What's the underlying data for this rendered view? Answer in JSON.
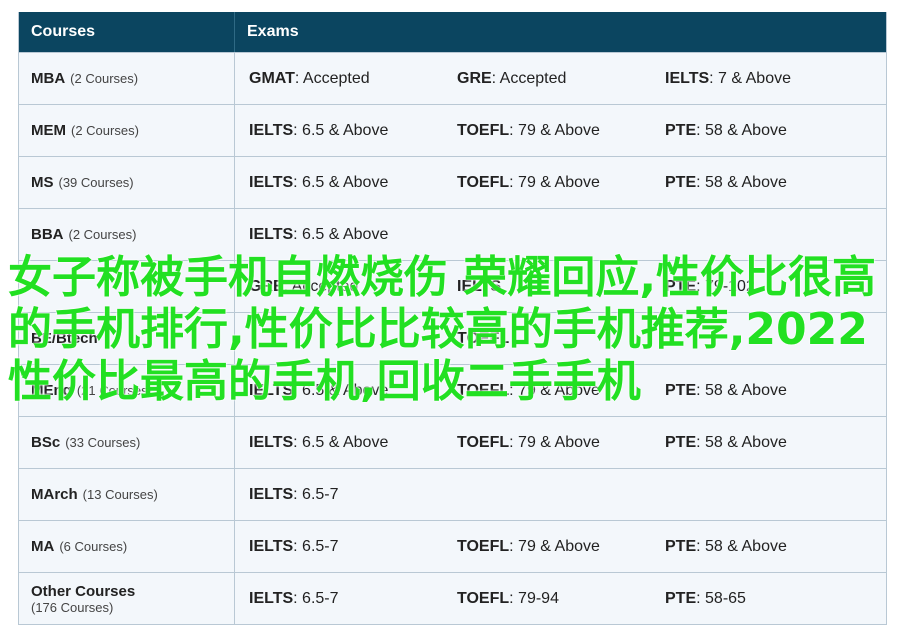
{
  "header": {
    "courses": "Courses",
    "exams": "Exams"
  },
  "rows": [
    {
      "name": "MBA",
      "count": "(2 Courses)",
      "exams": [
        {
          "name": "GMAT",
          "value": ": Accepted"
        },
        {
          "name": "GRE",
          "value": ": Accepted"
        },
        {
          "name": "IELTS",
          "value": ": 7 & Above"
        }
      ]
    },
    {
      "name": "MEM",
      "count": "(2 Courses)",
      "exams": [
        {
          "name": "IELTS",
          "value": ": 6.5 & Above"
        },
        {
          "name": "TOEFL",
          "value": ": 79 & Above"
        },
        {
          "name": "PTE",
          "value": ": 58 & Above"
        }
      ]
    },
    {
      "name": "MS",
      "count": "(39 Courses)",
      "exams": [
        {
          "name": "IELTS",
          "value": ": 6.5 & Above"
        },
        {
          "name": "TOEFL",
          "value": ": 79 & Above"
        },
        {
          "name": "PTE",
          "value": ": 58 & Above"
        }
      ]
    },
    {
      "name": "BBA",
      "count": "(2 Courses)",
      "exams": [
        {
          "name": "IELTS",
          "value": ": 6.5 & Above"
        }
      ]
    },
    {
      "name": "",
      "count": "",
      "exams": [
        {
          "name": "GRE",
          "value": ": Accepted"
        },
        {
          "name": "IELTS",
          "value": ""
        },
        {
          "name": "PTE",
          "value": ": 79-102"
        }
      ]
    },
    {
      "name": "BE/Btech",
      "count": "",
      "exams": [
        {
          "name": "",
          "value": ""
        },
        {
          "name": "TOEFL",
          "value": ""
        },
        {
          "name": "",
          "value": ""
        }
      ]
    },
    {
      "name": "MEng",
      "count": "(21 Courses)",
      "exams": [
        {
          "name": "IELTS",
          "value": ": 6.5 & Above"
        },
        {
          "name": "TOEFL",
          "value": ": 79 & Above"
        },
        {
          "name": "PTE",
          "value": ": 58 & Above"
        }
      ]
    },
    {
      "name": "BSc",
      "count": "(33 Courses)",
      "exams": [
        {
          "name": "IELTS",
          "value": ": 6.5 & Above"
        },
        {
          "name": "TOEFL",
          "value": ": 79 & Above"
        },
        {
          "name": "PTE",
          "value": ": 58 & Above"
        }
      ]
    },
    {
      "name": "MArch",
      "count": "(13 Courses)",
      "exams": [
        {
          "name": "IELTS",
          "value": ": 6.5-7"
        }
      ]
    },
    {
      "name": "MA",
      "count": "(6 Courses)",
      "exams": [
        {
          "name": "IELTS",
          "value": ": 6.5-7"
        },
        {
          "name": "TOEFL",
          "value": ": 79 & Above"
        },
        {
          "name": "PTE",
          "value": ": 58 & Above"
        }
      ]
    },
    {
      "name": "Other Courses",
      "count": "(176 Courses)",
      "stacked": true,
      "exams": [
        {
          "name": "IELTS",
          "value": ": 6.5-7"
        },
        {
          "name": "TOEFL",
          "value": ": 79-94"
        },
        {
          "name": "PTE",
          "value": ": 58-65"
        }
      ]
    }
  ],
  "overlay_text": "女子称被手机自燃烧伤 荣耀回应,性价比很高的手机排行,性价比比较高的手机推荐,2022性价比最高的手机,回收二手手机",
  "colors": {
    "header_bg": "#0b4560",
    "row_bg": "#f3f7fb",
    "border": "#b9c8d4",
    "overlay": "#22e022"
  }
}
